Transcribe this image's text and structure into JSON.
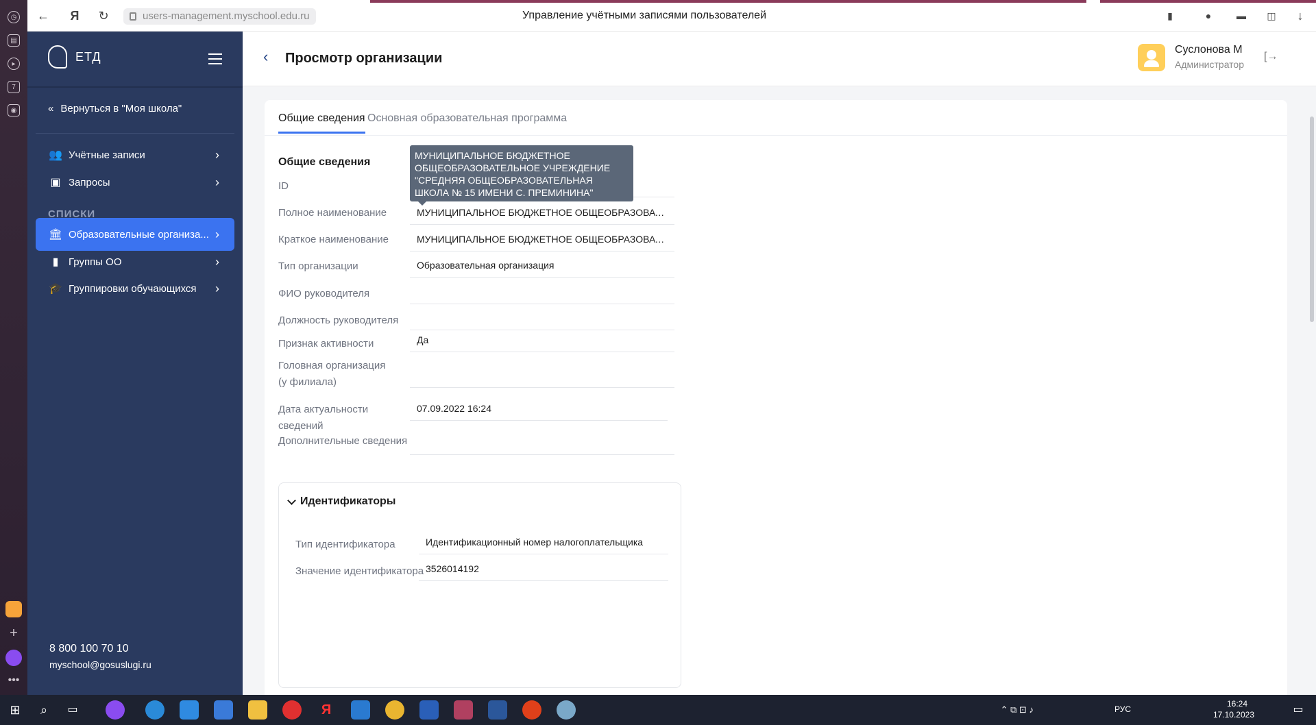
{
  "browser": {
    "url": "users-management.myschool.edu.ru",
    "page_title": "Управление учётными записями пользователей"
  },
  "sidebar": {
    "logo": "ЕТД",
    "back_link": "Вернуться в \"Моя школа\"",
    "items": [
      {
        "label": "Учётные записи",
        "icon": "users-icon"
      },
      {
        "label": "Запросы",
        "icon": "inbox-icon"
      }
    ],
    "section_label": "СПИСКИ",
    "list_items": [
      {
        "label": "Образовательные организа...",
        "icon": "institution-icon",
        "active": true
      },
      {
        "label": "Группы ОО",
        "icon": "bookmark-icon",
        "active": false
      },
      {
        "label": "Группировки обучающихся",
        "icon": "graduation-cap-icon",
        "active": false
      }
    ],
    "phone": "8 800 100 70 10",
    "email": "myschool@gosuslugi.ru"
  },
  "header": {
    "title": "Просмотр организации",
    "user_name": "Суслонова М",
    "user_role": "Администратор"
  },
  "tabs": [
    {
      "label": "Общие сведения",
      "active": true
    },
    {
      "label": "Основная образовательная программа",
      "active": false
    }
  ],
  "general": {
    "section_title": "Общие сведения",
    "tooltip": "МУНИЦИПАЛЬНОЕ БЮДЖЕТНОЕ ОБЩЕОБРАЗОВАТЕЛЬНОЕ УЧРЕЖДЕНИЕ \"СРЕДНЯЯ ОБЩЕОБРАЗОВАТЕЛЬНАЯ ШКОЛА № 15 ИМЕНИ С. ПРЕМИНИНА\"",
    "fields": [
      {
        "label": "ID",
        "value": ""
      },
      {
        "label": "Полное наименование",
        "value": "МУНИЦИПАЛЬНОЕ БЮДЖЕТНОЕ ОБЩЕОБРАЗОВАТЕЛЬНОЕ УЧ..."
      },
      {
        "label": "Краткое наименование",
        "value": "МУНИЦИПАЛЬНОЕ БЮДЖЕТНОЕ ОБЩЕОБРАЗОВАТЕЛЬНОЕ УЧ..."
      },
      {
        "label": "Тип организации",
        "value": "Образовательная организация"
      },
      {
        "label": "ФИО руководителя",
        "value": ""
      },
      {
        "label": "Должность руководителя",
        "value": ""
      },
      {
        "label": "Признак активности",
        "value": "Да"
      },
      {
        "label": "Головная организация (у филиала)",
        "value": ""
      },
      {
        "label": "Дата актуальности сведений",
        "value": "07.09.2022 16:24"
      },
      {
        "label": "Дополнительные сведения",
        "value": ""
      }
    ]
  },
  "identifiers": {
    "title": "Идентификаторы",
    "fields": [
      {
        "label": "Тип идентификатора",
        "value": "Идентификационный номер налогоплательщика"
      },
      {
        "label": "Значение идентификатора",
        "value": "3526014192"
      }
    ]
  },
  "taskbar": {
    "lang": "РУС",
    "time": "16:24",
    "date": "17.10.2023"
  }
}
